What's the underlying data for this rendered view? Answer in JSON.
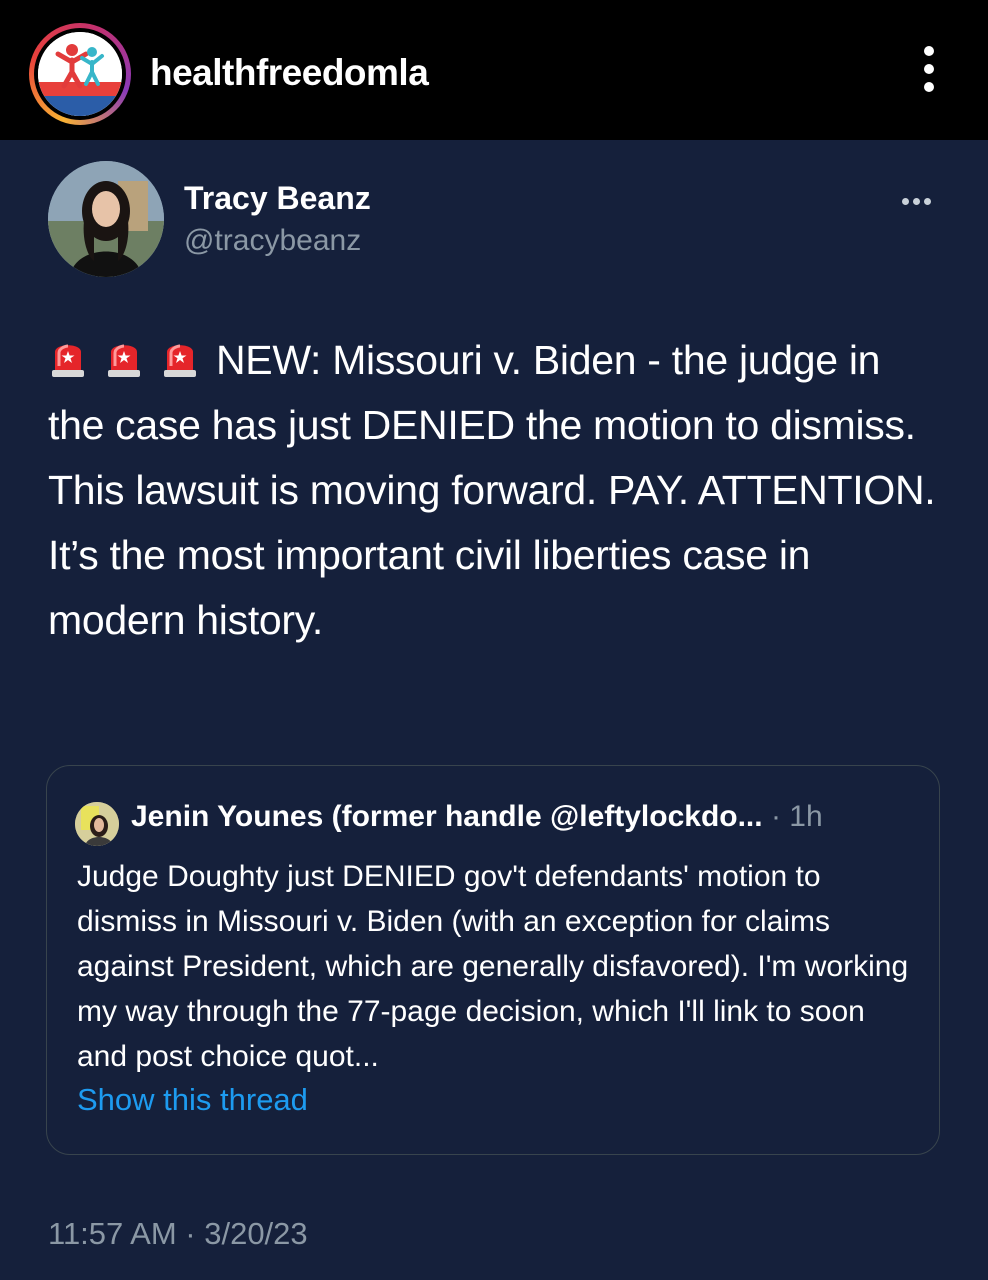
{
  "header": {
    "account_username": "healthfreedomla",
    "avatar_icon": "health-freedom-logo-icon",
    "menu_icon": "kebab-vertical-icon"
  },
  "tweet": {
    "author_name": "Tracy Beanz",
    "author_handle": "@tracybeanz",
    "more_icon": "ellipsis-horizontal-icon",
    "siren_icon": "police-siren-emoji-icon",
    "text": "NEW: Missouri v. Biden - the judge in the case has just DENIED the motion to dismiss. This lawsuit is moving forward. PAY. ATTENTION. It’s the most important civil liberties case in modern history.",
    "timestamp": "11:57 AM · 3/20/23"
  },
  "quoted_tweet": {
    "author": "Jenin Younes (former handle @leftylockdo...",
    "time": " · 1h",
    "text": "Judge Doughty just DENIED gov't defendants' motion to dismiss in Missouri v. Biden (with an exception for claims against President, which are generally disfavored). I'm working my way through the 77-page decision, which I'll link to soon and post choice quot...",
    "show_thread": "Show this thread"
  },
  "colors": {
    "background": "#000000",
    "card_background": "#15203b",
    "text_primary": "#ffffff",
    "text_secondary": "#8b98a5",
    "link": "#1d9bf0",
    "border": "#38444d"
  }
}
